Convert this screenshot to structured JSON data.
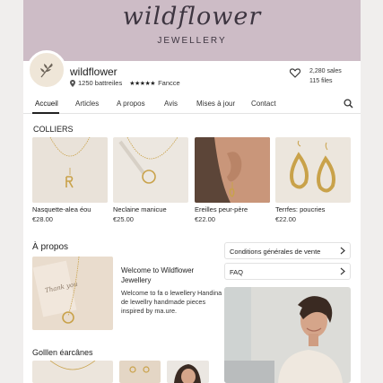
{
  "banner": {
    "logo_text": "wildflower",
    "subtitle": "JEWELLERY"
  },
  "shop": {
    "name": "wildflower",
    "location": "1250 battreiles",
    "stars": "★★★★★",
    "rating_label": "Fancce",
    "sales": "2,280 sales",
    "files": "115 files"
  },
  "tabs": [
    "Accueil",
    "Articles",
    "A propos",
    "Avis",
    "Mises à jour",
    "Contact"
  ],
  "active_tab": "Accueil",
  "collections": {
    "title": "COLLIERS",
    "items": [
      {
        "name": "Nasquette-alea éou",
        "price": "€28.00"
      },
      {
        "name": "Neclaine manicue",
        "price": "€25.00"
      },
      {
        "name": "Ereilles peur-père",
        "price": "€22.00"
      },
      {
        "name": "Terrfes: poucries",
        "price": "€22.00"
      }
    ]
  },
  "about": {
    "title": "À propos",
    "card_title": "Welcome to Wildflower Jewellery",
    "card_text": "Welcome to fa o lewellery Handina de lewellry handmade pieces inspired by ma.ure.",
    "card_note": "Thank you"
  },
  "links": [
    {
      "label": "Conditions générales de vente"
    },
    {
      "label": "FAQ"
    }
  ],
  "bottom": {
    "title": "Golllen éarcânes"
  },
  "colors": {
    "banner": "#cdbcc6",
    "gold": "#c9a24a",
    "background": "#ffffff"
  }
}
